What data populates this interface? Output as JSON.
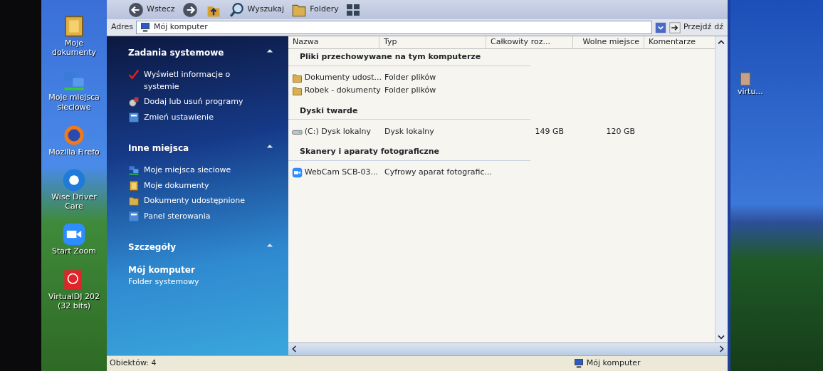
{
  "desktop_left": [
    {
      "label": "Moje dokumenty",
      "kind": "docs"
    },
    {
      "label": "Moje miejsca sieciowe",
      "kind": "network"
    },
    {
      "label": "Mozilla Firefo",
      "kind": "browser"
    },
    {
      "label": "Wise Driver Care",
      "kind": "gear"
    },
    {
      "label": "Start Zoom",
      "kind": "camera"
    },
    {
      "label": "VirtualDJ 202 (32 bits)",
      "kind": "dj"
    }
  ],
  "desktop_right": [
    {
      "label": "virtu...",
      "kind": "file"
    }
  ],
  "toolbar": {
    "back": "Wstecz",
    "search": "Wyszukaj",
    "folders": "Foldery"
  },
  "address": {
    "label": "Adres",
    "value": "Mój komputer",
    "go": "Przejdź",
    "behind": "dź"
  },
  "task_panels": [
    {
      "title": "Zadania systemowe",
      "expanded": true,
      "items": [
        {
          "label": "Wyświetl informacje o systemie",
          "kind": "check"
        },
        {
          "label": "Dodaj lub usuń programy",
          "kind": "cd"
        },
        {
          "label": "Zmień ustawienie",
          "kind": "panel"
        }
      ]
    },
    {
      "title": "Inne miejsca",
      "expanded": true,
      "items": [
        {
          "label": "Moje miejsca sieciowe",
          "kind": "network"
        },
        {
          "label": "Moje dokumenty",
          "kind": "docs"
        },
        {
          "label": "Dokumenty udostępnione",
          "kind": "folder"
        },
        {
          "label": "Panel sterowania",
          "kind": "panel"
        }
      ]
    },
    {
      "title": "Szczegóły",
      "expanded": true,
      "details": {
        "name": "Mój komputer",
        "type": "Folder systemowy"
      }
    }
  ],
  "columns": [
    "Nazwa",
    "Typ",
    "Całkowity roz...",
    "Wolne miejsce",
    "Komentarze"
  ],
  "groups": [
    {
      "title": "Pliki przechowywane na tym komputerze",
      "rows": [
        {
          "kind": "folder",
          "cells": [
            "Dokumenty udost...",
            "Folder plików",
            "",
            ""
          ]
        },
        {
          "kind": "folder",
          "cells": [
            "Robek - dokumenty",
            "Folder plików",
            "",
            ""
          ]
        }
      ]
    },
    {
      "title": "Dyski twarde",
      "rows": [
        {
          "kind": "drive",
          "cells": [
            "(C:) Dysk lokalny",
            "Dysk lokalny",
            "149 GB",
            "120 GB"
          ]
        }
      ]
    },
    {
      "title": "Skanery i aparaty fotograficzne",
      "rows": [
        {
          "kind": "camera",
          "cells": [
            "WebCam SCB-03...",
            "Cyfrowy aparat fotografic...",
            "",
            ""
          ]
        }
      ]
    }
  ],
  "status_bar": {
    "count": "Obiektów: 4",
    "location": "Mój komputer"
  }
}
